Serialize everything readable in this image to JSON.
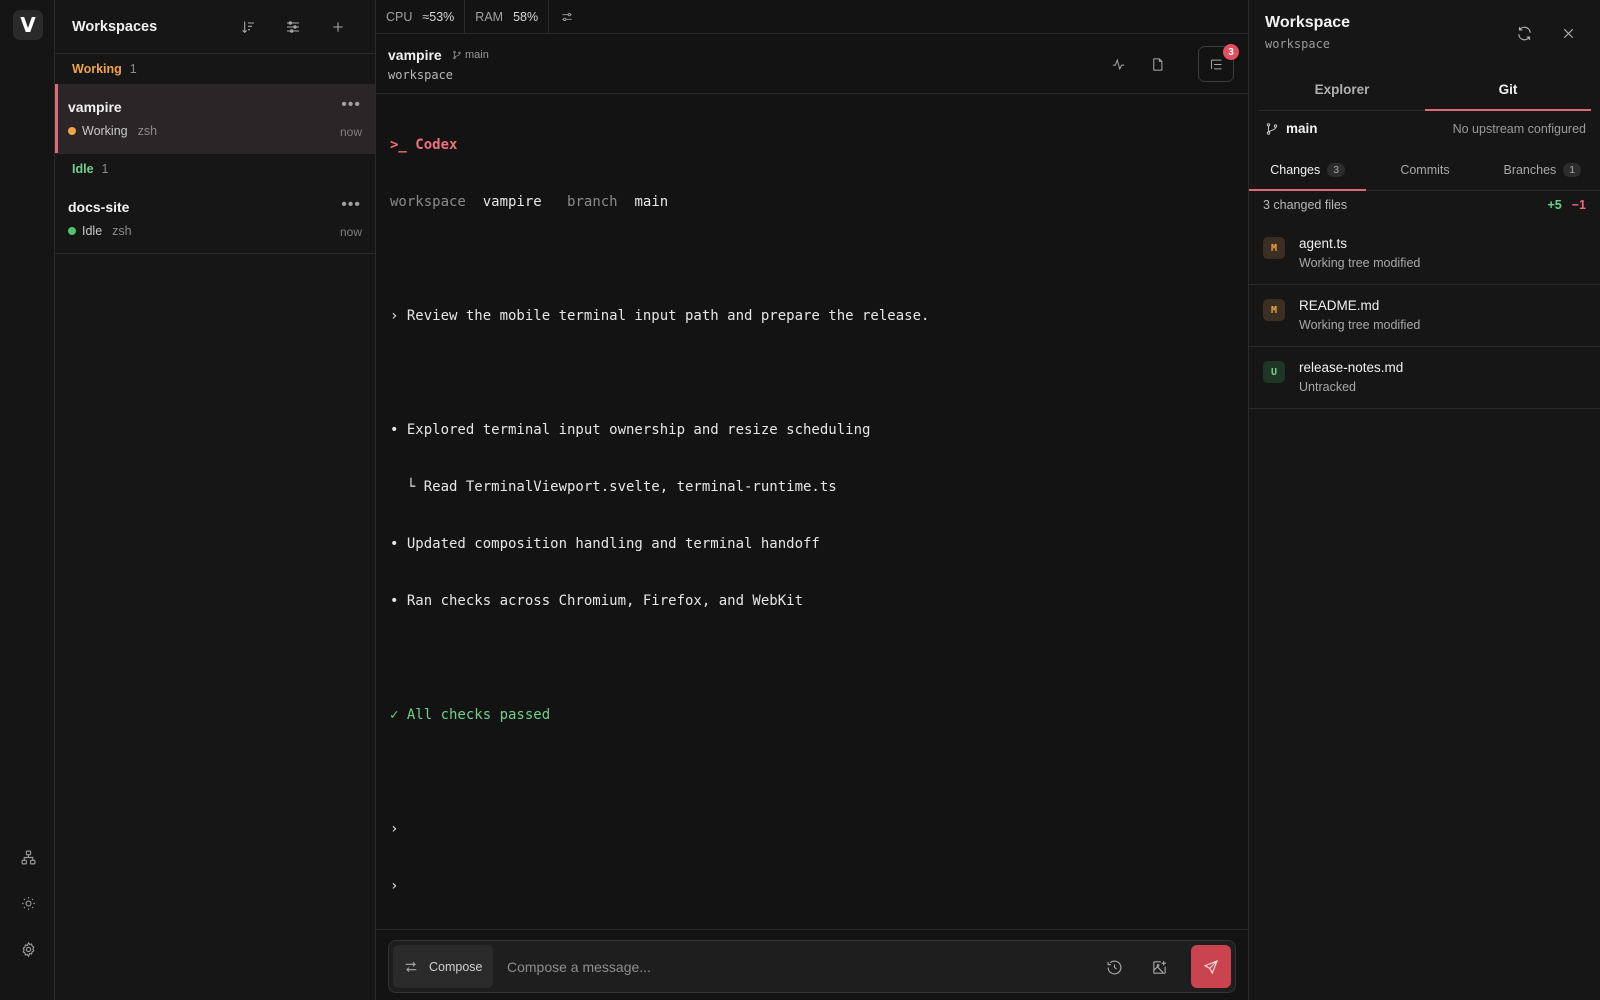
{
  "app": {
    "logo_letter": "V",
    "rail_icons": [
      "network-icon",
      "sun-icon",
      "gear-icon"
    ]
  },
  "sidebar": {
    "title": "Workspaces",
    "groups": [
      {
        "label": "Working",
        "count": "1",
        "color": "#f0a545",
        "items": [
          {
            "name": "vampire",
            "status": "Working",
            "shell": "zsh",
            "time": "now",
            "dot_color": "#f0a545",
            "active": true
          }
        ]
      },
      {
        "label": "Idle",
        "count": "1",
        "color": "#6fd08c",
        "items": [
          {
            "name": "docs-site",
            "status": "Idle",
            "shell": "zsh",
            "time": "now",
            "dot_color": "#4fc36b",
            "active": false
          }
        ]
      }
    ]
  },
  "statusbar": {
    "cpu_label": "CPU",
    "cpu_value": "≈53%",
    "ram_label": "RAM",
    "ram_value": "58%"
  },
  "terminal_header": {
    "name": "vampire",
    "branch": "main",
    "subtitle": "workspace",
    "badge_count": "3"
  },
  "terminal": {
    "prompt_title": ">_ Codex",
    "meta": {
      "workspace_label": "workspace",
      "workspace_value": "vampire",
      "branch_label": "branch",
      "branch_value": "main"
    },
    "user_prompt": "› Review the mobile terminal input path and prepare the release.",
    "bullets": [
      "• Explored terminal input ownership and resize scheduling",
      "  └ Read TerminalViewport.svelte, terminal-runtime.ts",
      "• Updated composition handling and terminal handoff",
      "• Ran checks across Chromium, Firefox, and WebKit"
    ],
    "result": "✓ All checks passed",
    "prompts": [
      "›",
      "›"
    ]
  },
  "composer": {
    "mode_label": "Compose",
    "placeholder": "Compose a message..."
  },
  "panel": {
    "title": "Workspace",
    "subtitle": "workspace",
    "tabs": [
      "Explorer",
      "Git"
    ],
    "active_tab": "Git",
    "branch": "main",
    "upstream": "No upstream configured",
    "subtabs": [
      {
        "label": "Changes",
        "count": "3"
      },
      {
        "label": "Commits",
        "count": ""
      },
      {
        "label": "Branches",
        "count": "1"
      }
    ],
    "summary": "3 changed files",
    "additions": "+5",
    "deletions": "−1",
    "files": [
      {
        "badge": "M",
        "name": "agent.ts",
        "state": "Working tree modified"
      },
      {
        "badge": "M",
        "name": "README.md",
        "state": "Working tree modified"
      },
      {
        "badge": "U",
        "name": "release-notes.md",
        "state": "Untracked"
      }
    ]
  },
  "colors": {
    "accent": "#e06a74",
    "send": "#c9444f",
    "working": "#f0a545",
    "idle": "#6fd08c"
  }
}
